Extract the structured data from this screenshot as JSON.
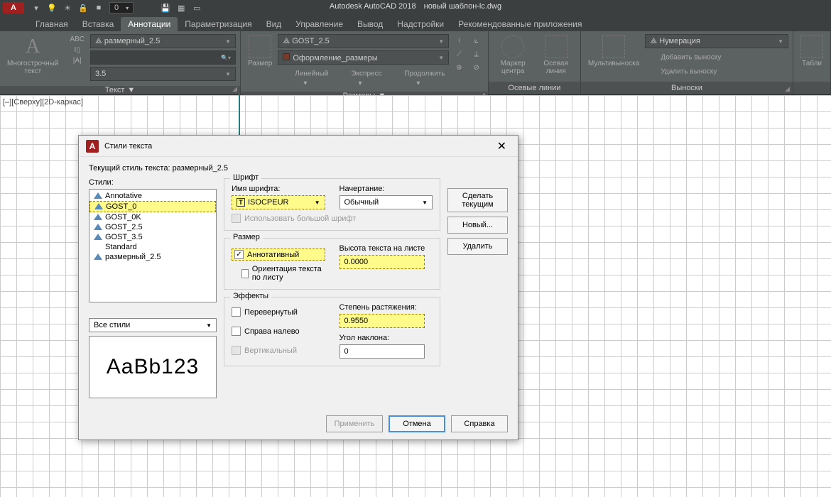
{
  "title": {
    "app": "Autodesk AutoCAD 2018",
    "doc": "новый шаблон-lc.dwg"
  },
  "qat": {
    "spin": "0"
  },
  "tabs": [
    "Главная",
    "Вставка",
    "Аннотации",
    "Параметризация",
    "Вид",
    "Управление",
    "Вывод",
    "Надстройки",
    "Рекомендованные приложения"
  ],
  "active_tab": 2,
  "ribbon": {
    "text": {
      "big": "Многострочный\nтекст",
      "drop1": "размерный_2.5",
      "drop3": "3.5",
      "label": "Текст"
    },
    "dim": {
      "big": "Размер",
      "drop1": "GOST_2.5",
      "drop2": "Оформление_размеры",
      "b1": "Линейный",
      "b2": "Экспресс",
      "b3": "Продолжить",
      "label": "Размеры"
    },
    "axis": {
      "b1": "Маркер центра",
      "b2": "Осевая линия",
      "label": "Осевые линии"
    },
    "leader": {
      "big": "Мультивыноска",
      "drop": "Нумерация",
      "l1": "Добавить выноску",
      "l2": "Удалить выноску",
      "label": "Выноски"
    },
    "table": {
      "big": "Табли"
    }
  },
  "viewport": {
    "corner": "[–][Сверху][2D-каркас]"
  },
  "dialog": {
    "title": "Стили текста",
    "current_label": "Текущий стиль текста:",
    "current": "размерный_2.5",
    "styles_label": "Стили:",
    "styles": [
      "Annotative",
      "GOST_0",
      "GOST_0K",
      "GOST_2.5",
      "GOST_3.5",
      "Standard",
      "размерный_2.5"
    ],
    "selected_style_idx": 1,
    "filter": "Все стили",
    "preview": "AaBb123",
    "font": {
      "group": "Шрифт",
      "name_label": "Имя шрифта:",
      "name": "ISOCPEUR",
      "style_label": "Начертание:",
      "style": "Обычный",
      "bigfont": "Использовать большой шрифт"
    },
    "size": {
      "group": "Размер",
      "annot": "Аннотативный",
      "orient": "Ориентация текста по листу",
      "height_label": "Высота текста на листе",
      "height": "0.0000"
    },
    "fx": {
      "group": "Эффекты",
      "upside": "Перевернутый",
      "rtl": "Справа налево",
      "vert": "Вертикальный",
      "width_label": "Степень растяжения:",
      "width": "0.9550",
      "angle_label": "Угол наклона:",
      "angle": "0"
    },
    "btn": {
      "setcur": "Сделать текущим",
      "new": "Новый...",
      "del": "Удалить",
      "apply": "Применить",
      "cancel": "Отмена",
      "help": "Справка"
    }
  }
}
